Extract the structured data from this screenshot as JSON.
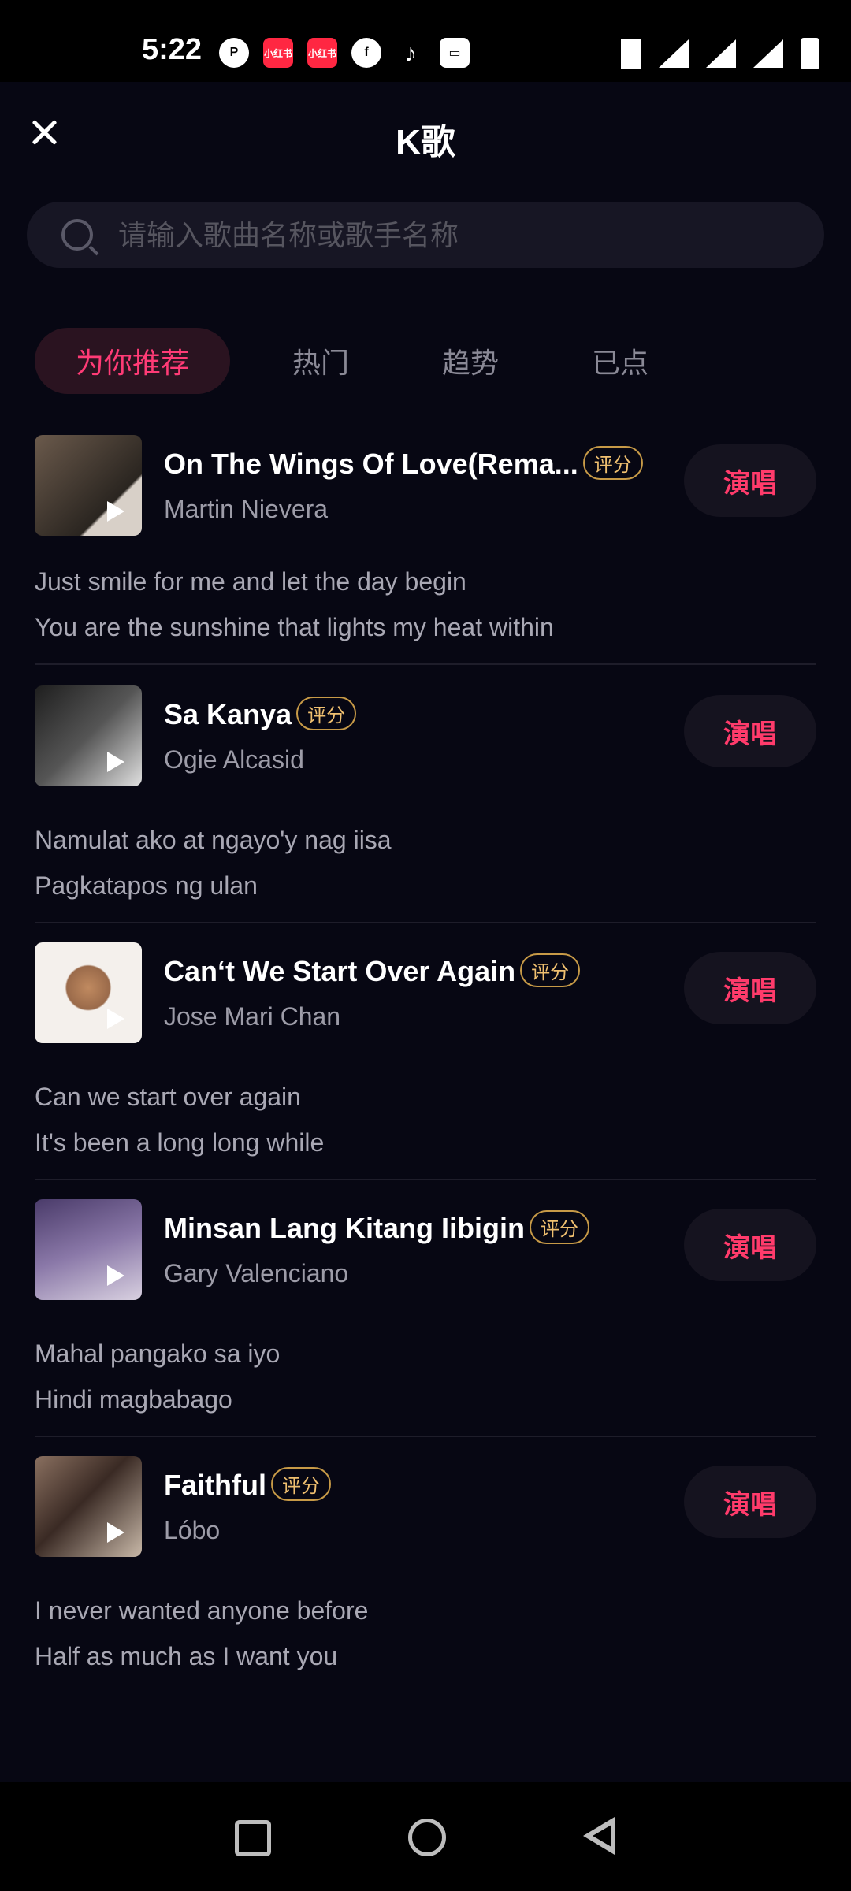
{
  "status_bar": {
    "time": "5:22",
    "left_icons": [
      "p-icon",
      "xiaohongshu-icon",
      "xiaohongshu-icon",
      "facebook-icon",
      "tiktok-icon",
      "wallet-icon"
    ],
    "xhs_label": "小红书",
    "right_icons": [
      "vibrate-icon",
      "wifi-icon",
      "signal-icon",
      "signal-icon",
      "battery-charging-icon"
    ]
  },
  "header": {
    "title": "K歌"
  },
  "search": {
    "placeholder": "请输入歌曲名称或歌手名称"
  },
  "tabs": [
    {
      "label": "为你推荐",
      "active": true
    },
    {
      "label": "热门",
      "active": false
    },
    {
      "label": "趋势",
      "active": false
    },
    {
      "label": "已点",
      "active": false
    }
  ],
  "score_label": "评分",
  "sing_label": "演唱",
  "songs": [
    {
      "title": "On The Wings Of Love(Rema...",
      "artist": "Martin Nievera",
      "lyrics": [
        "Just smile for me and let the day begin",
        "You are the sunshine that lights my heat within"
      ],
      "cover_color": "#4a4038"
    },
    {
      "title": "Sa Kanya",
      "artist": "Ogie Alcasid",
      "lyrics": [
        "Namulat ako at ngayo'y nag iisa",
        "Pagkatapos ng ulan"
      ],
      "cover_color": "#3a3a3a"
    },
    {
      "title": "Can‘t We Start Over Again",
      "artist": "Jose Mari Chan",
      "lyrics": [
        "Can we start over again",
        "It's been a long long while"
      ],
      "cover_color": "#e8e0d8"
    },
    {
      "title": "Minsan Lang Kitang Iibigin",
      "artist": "Gary Valenciano",
      "lyrics": [
        "Mahal pangako sa iyo",
        "Hindi magbabago"
      ],
      "cover_color": "#6d5a8a"
    },
    {
      "title": "Faithful",
      "artist": "Lóbo",
      "lyrics": [
        "I never wanted anyone before",
        "Half as much as I want you"
      ],
      "cover_color": "#5a4a40"
    }
  ]
}
